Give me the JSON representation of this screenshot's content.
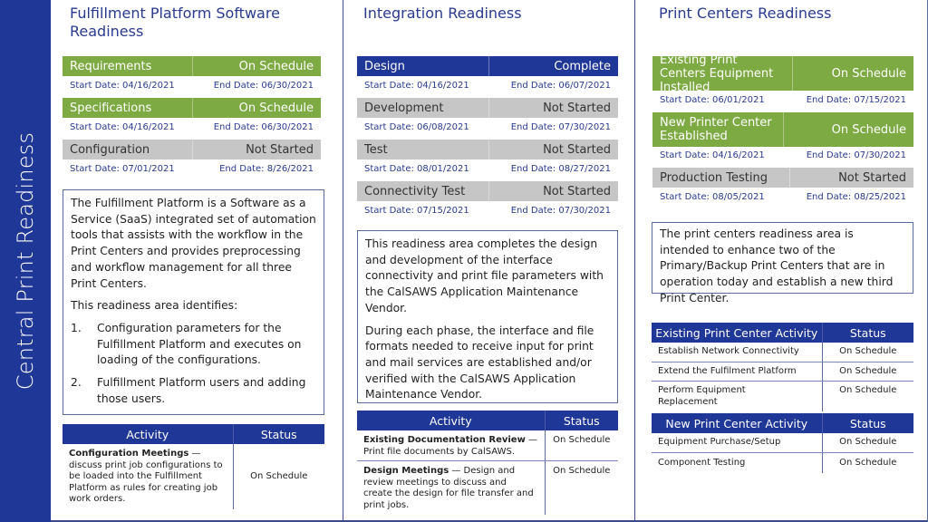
{
  "sidebar": {
    "title": "Central Print Readiness",
    "color": "#1f3796"
  },
  "colors": {
    "on_schedule": "#7daa43",
    "complete": "#1f3796",
    "not_started": "#c6c6c6",
    "title": "#2a3a8e"
  },
  "fulfillment": {
    "title": "Fulfillment Platform Software Readiness",
    "phases": [
      {
        "name": "Requirements",
        "status": "On Schedule",
        "start": "Start Date: 04/16/2021",
        "end": "End Date: 06/30/2021"
      },
      {
        "name": "Specifications",
        "status": "On Schedule",
        "start": "Start Date: 04/16/2021",
        "end": "End Date: 06/30/2021"
      },
      {
        "name": "Configuration",
        "status": "Not Started",
        "start": "Start Date: 07/01/2021",
        "end": "End Date: 8/26/2021"
      }
    ],
    "description": {
      "p1": "The Fulfillment Platform is a Software as a Service (SaaS) integrated set of automation tools that assists with the workflow in the Print Centers and provides preprocessing and workflow management for all three Print Centers.",
      "p2": "This readiness area identifies:",
      "items": [
        {
          "num": "1.",
          "text": "Configuration parameters for the Fulfillment Platform and executes on loading of the configurations."
        },
        {
          "num": "2.",
          "text": "Fulfillment Platform users and adding those users."
        }
      ]
    },
    "activity_table": {
      "headers": [
        "Activity",
        "Status"
      ],
      "rows": [
        {
          "bold": "Configuration Meetings",
          "text": " — discuss print job configurations to be loaded into the Fulfillment Platform as rules for creating job work orders.",
          "status": "On Schedule"
        }
      ]
    }
  },
  "integration": {
    "title": "Integration Readiness",
    "phases": [
      {
        "name": "Design",
        "status": "Complete",
        "start": "Start Date: 04/16/2021",
        "end": "End Date: 06/07/2021"
      },
      {
        "name": "Development",
        "status": "Not Started",
        "start": "Start Date: 06/08/2021",
        "end": "End Date: 07/30/2021"
      },
      {
        "name": "Test",
        "status": "Not Started",
        "start": "Start Date: 08/01/2021",
        "end": "End Date: 08/27/2021"
      },
      {
        "name": "Connectivity Test",
        "status": "Not Started",
        "start": "Start Date: 07/15/2021",
        "end": "End Date: 07/30/2021"
      }
    ],
    "description": {
      "p1": "This readiness area completes the design and development of the interface connectivity and print file parameters with the CalSAWS Application Maintenance Vendor.",
      "p2": "During each phase, the interface and file formats needed to receive input for print and mail services are established and/or verified with the CalSAWS Application Maintenance Vendor."
    },
    "activity_table": {
      "headers": [
        "Activity",
        "Status"
      ],
      "rows": [
        {
          "bold": "Existing Documentation Review",
          "text": " — Print file documents by CalSAWS.",
          "status": "On Schedule"
        },
        {
          "bold": "Design Meetings",
          "text": " — Design and review meetings to discuss and create the design for file transfer and print jobs.",
          "status": "On Schedule"
        }
      ]
    }
  },
  "print_centers": {
    "title": "Print Centers Readiness",
    "phases": [
      {
        "name": "Existing Print Centers Equipment Installed",
        "status": "On Schedule",
        "start": "Start Date: 06/01/2021",
        "end": "End Date: 07/15/2021"
      },
      {
        "name": "New Printer Center Established",
        "status": "On Schedule",
        "start": "Start Date: 04/16/2021",
        "end": "End Date: 07/30/2021"
      },
      {
        "name": "Production Testing",
        "status": "Not Started",
        "start": "Start Date: 08/05/2021",
        "end": "End Date: 08/25/2021"
      }
    ],
    "description": {
      "p1": "The print centers readiness area is intended to enhance two of the Primary/Backup Print Centers that are in operation today and establish a new third Print Center."
    },
    "existing_table": {
      "headers": [
        "Existing Print Center Activity",
        "Status"
      ],
      "rows": [
        {
          "activity": "Establish Network Connectivity",
          "status": "On Schedule"
        },
        {
          "activity": "Extend the Fulfilment Platform",
          "status": "On Schedule"
        },
        {
          "activity": "Perform Equipment Replacement",
          "status": "On Schedule"
        }
      ]
    },
    "new_table": {
      "headers": [
        "New Print Center Activity",
        "Status"
      ],
      "rows": [
        {
          "activity": "Equipment Purchase/Setup",
          "status": "On Schedule"
        },
        {
          "activity": "Component Testing",
          "status": "On Schedule"
        }
      ]
    }
  }
}
